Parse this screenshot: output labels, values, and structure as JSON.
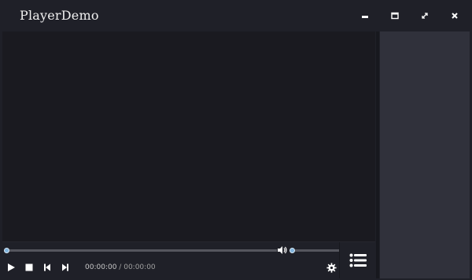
{
  "window": {
    "title": "PlayerDemo",
    "buttons": {
      "minimize": "minimize-icon",
      "maximize": "maximize-icon",
      "fullscreen": "fullscreen-icon",
      "close": "close-icon"
    }
  },
  "player": {
    "progress": 0,
    "volume": 0,
    "current_time": "00:00:00",
    "separator": "/",
    "duration": "00:00:00"
  },
  "controls": {
    "play": "play-icon",
    "stop": "stop-icon",
    "previous": "previous-icon",
    "next": "next-icon",
    "volume": "volume-icon",
    "settings": "gear-icon",
    "playlist": "playlist-icon"
  },
  "colors": {
    "background": "#1f2028",
    "video_area": "#1a1a20",
    "sidebar": "#30313b",
    "accent": "#7fb3dc"
  }
}
